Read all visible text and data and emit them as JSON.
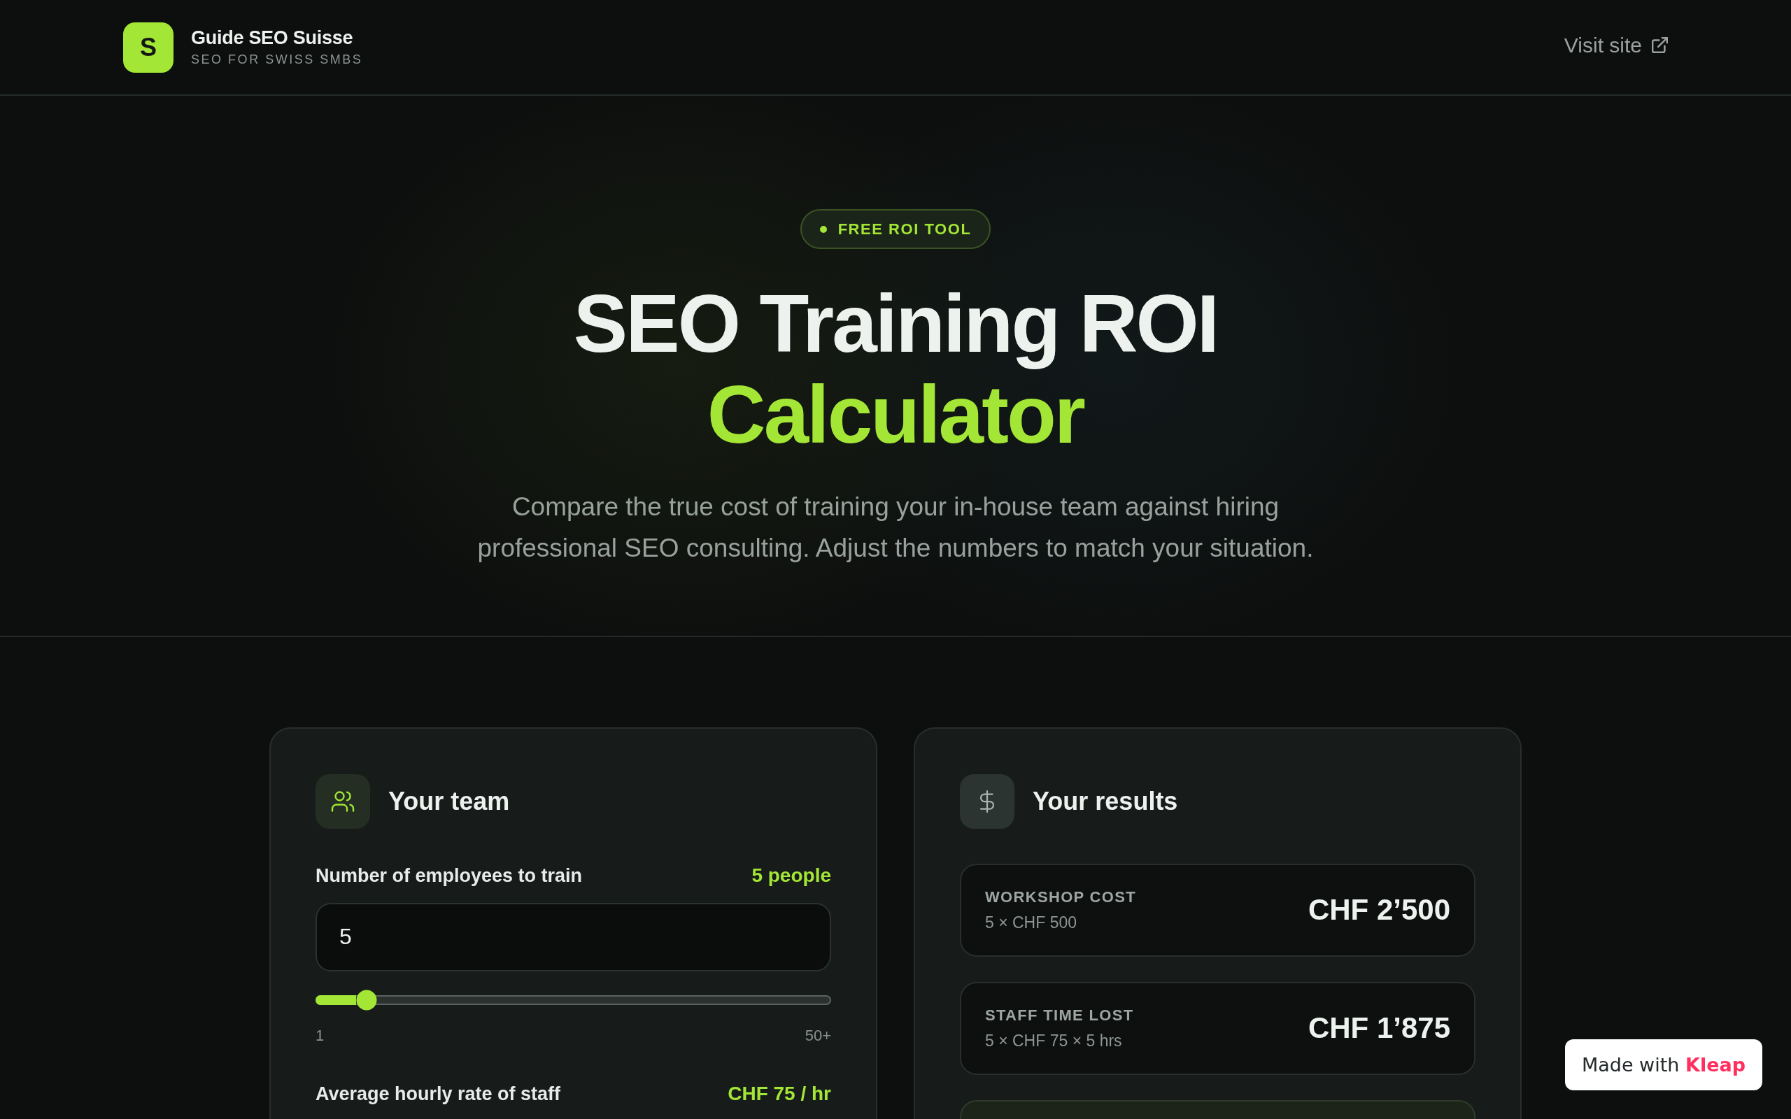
{
  "header": {
    "logo_letter": "S",
    "brand_name": "Guide SEO Suisse",
    "tagline": "SEO FOR SWISS SMBS",
    "link": "Visit site"
  },
  "hero": {
    "badge": "FREE ROI TOOL",
    "title": "SEO Training ROI",
    "title_highlight": "Calculator",
    "subtitle": "Compare the true cost of training your in-house team against hiring professional SEO consulting. Adjust the numbers to match your situation."
  },
  "team_card": {
    "title": "Your team",
    "fields": [
      {
        "label": "Number of employees to train",
        "reading": "5 people",
        "input": {
          "value": "5"
        },
        "slider": {
          "level": 0.08,
          "min_label": "1",
          "max_label": "50+"
        }
      },
      {
        "label": "Average hourly rate of staff",
        "reading": "CHF 75 / hr"
      }
    ]
  },
  "results_card": {
    "title": "Your results",
    "rows": [
      {
        "kind": "cost",
        "label": "WORKSHOP COST",
        "formula": "5 × CHF 500",
        "amount": "CHF 2’500"
      },
      {
        "kind": "cost",
        "label": "STAFF TIME LOST",
        "formula": "5 × CHF 75 × 5 hrs",
        "amount": "CHF 1’875"
      },
      {
        "kind": "highlight"
      }
    ]
  },
  "builder_badge": {
    "text": "Made with **Kleap**"
  }
}
